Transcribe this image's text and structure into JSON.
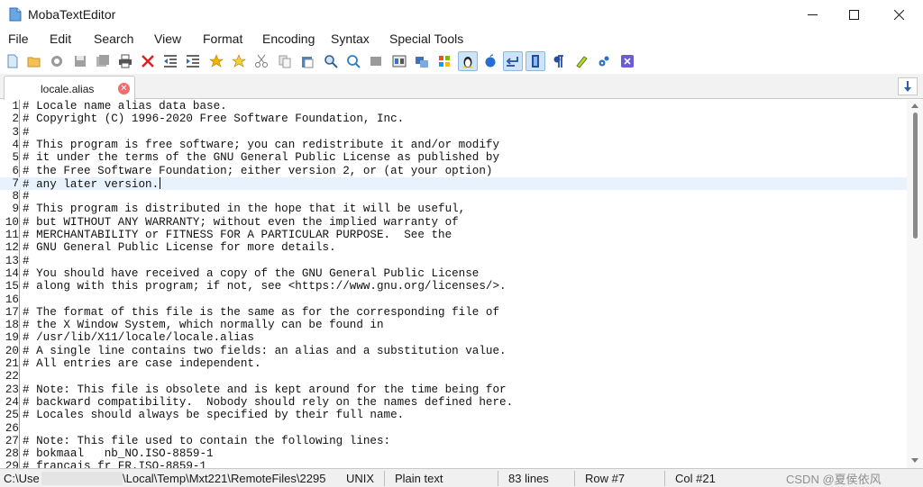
{
  "window": {
    "title": "MobaTextEditor",
    "minimize_icon": "minimize-icon",
    "maximize_icon": "maximize-icon",
    "close_icon": "close-icon"
  },
  "menu": [
    "File",
    "Edit",
    "Search",
    "View",
    "Format",
    "Encoding",
    "Syntax",
    "Special Tools"
  ],
  "toolbar": {
    "buttons": [
      "new-file-icon",
      "open-folder-icon",
      "reload-icon",
      "save-icon",
      "save-all-icon",
      "print-icon",
      "close-x-icon",
      "indent-decrease-icon",
      "indent-increase-icon",
      "bookmark-star-icon",
      "bookmark-next-icon",
      "cut-icon",
      "copy-icon",
      "paste-icon",
      "search-icon",
      "replace-icon",
      "fullscreen-icon",
      "split-view-icon",
      "compare-icon",
      "windows-icon",
      "linux-icon",
      "apple-icon",
      "word-wrap-icon",
      "column-mode-icon",
      "pilcrow-icon",
      "highlighter-icon",
      "settings-icon",
      "plugin-icon"
    ],
    "active": [
      "linux-icon",
      "word-wrap-icon",
      "column-mode-icon"
    ]
  },
  "tabs": [
    {
      "label": "locale.alias",
      "close_icon": "tab-close-icon"
    }
  ],
  "tab_nav_icon": "arrow-down-icon",
  "editor": {
    "current_line": 7,
    "lines": [
      {
        "no": "1",
        "text": "# Locale name alias data base."
      },
      {
        "no": "2",
        "text": "# Copyright (C) 1996-2020 Free Software Foundation, Inc."
      },
      {
        "no": "3",
        "text": "#"
      },
      {
        "no": "4",
        "text": "# This program is free software; you can redistribute it and/or modify"
      },
      {
        "no": "5",
        "text": "# it under the terms of the GNU General Public License as published by"
      },
      {
        "no": "6",
        "text": "# the Free Software Foundation; either version 2, or (at your option)"
      },
      {
        "no": "7",
        "text": "# any later version."
      },
      {
        "no": "8",
        "text": "#"
      },
      {
        "no": "9",
        "text": "# This program is distributed in the hope that it will be useful,"
      },
      {
        "no": "10",
        "text": "# but WITHOUT ANY WARRANTY; without even the implied warranty of"
      },
      {
        "no": "11",
        "text": "# MERCHANTABILITY or FITNESS FOR A PARTICULAR PURPOSE.  See the"
      },
      {
        "no": "12",
        "text": "# GNU General Public License for more details."
      },
      {
        "no": "13",
        "text": "#"
      },
      {
        "no": "14",
        "text": "# You should have received a copy of the GNU General Public License"
      },
      {
        "no": "15",
        "text": "# along with this program; if not, see <https://www.gnu.org/licenses/>."
      },
      {
        "no": "16",
        "text": ""
      },
      {
        "no": "17",
        "text": "# The format of this file is the same as for the corresponding file of"
      },
      {
        "no": "18",
        "text": "# the X Window System, which normally can be found in"
      },
      {
        "no": "19",
        "text": "# /usr/lib/X11/locale/locale.alias"
      },
      {
        "no": "20",
        "text": "# A single line contains two fields: an alias and a substitution value."
      },
      {
        "no": "21",
        "text": "# All entries are case independent."
      },
      {
        "no": "22",
        "text": ""
      },
      {
        "no": "23",
        "text": "# Note: This file is obsolete and is kept around for the time being for"
      },
      {
        "no": "24",
        "text": "# backward compatibility.  Nobody should rely on the names defined here."
      },
      {
        "no": "25",
        "text": "# Locales should always be specified by their full name."
      },
      {
        "no": "26",
        "text": ""
      },
      {
        "no": "27",
        "text": "# Note: This file used to contain the following lines:"
      },
      {
        "no": "28",
        "text": "# bokmaal   nb_NO.ISO-8859-1"
      },
      {
        "no": "29",
        "text": "# francais fr_FR.ISO-8859-1"
      }
    ]
  },
  "status": {
    "path_prefix": "C:\\Use",
    "path_suffix": "\\Local\\Temp\\Mxt221\\RemoteFiles\\2295",
    "line_ending": "UNIX",
    "syntax": "Plain text",
    "lines": "83 lines",
    "row": "Row #7",
    "col": "Col #21"
  },
  "watermark": "CSDN @夏侯依风",
  "colors": {
    "current_line": "#e8f2fc",
    "active_button": "#cde3f7",
    "tab_close": "#f26a6a"
  }
}
